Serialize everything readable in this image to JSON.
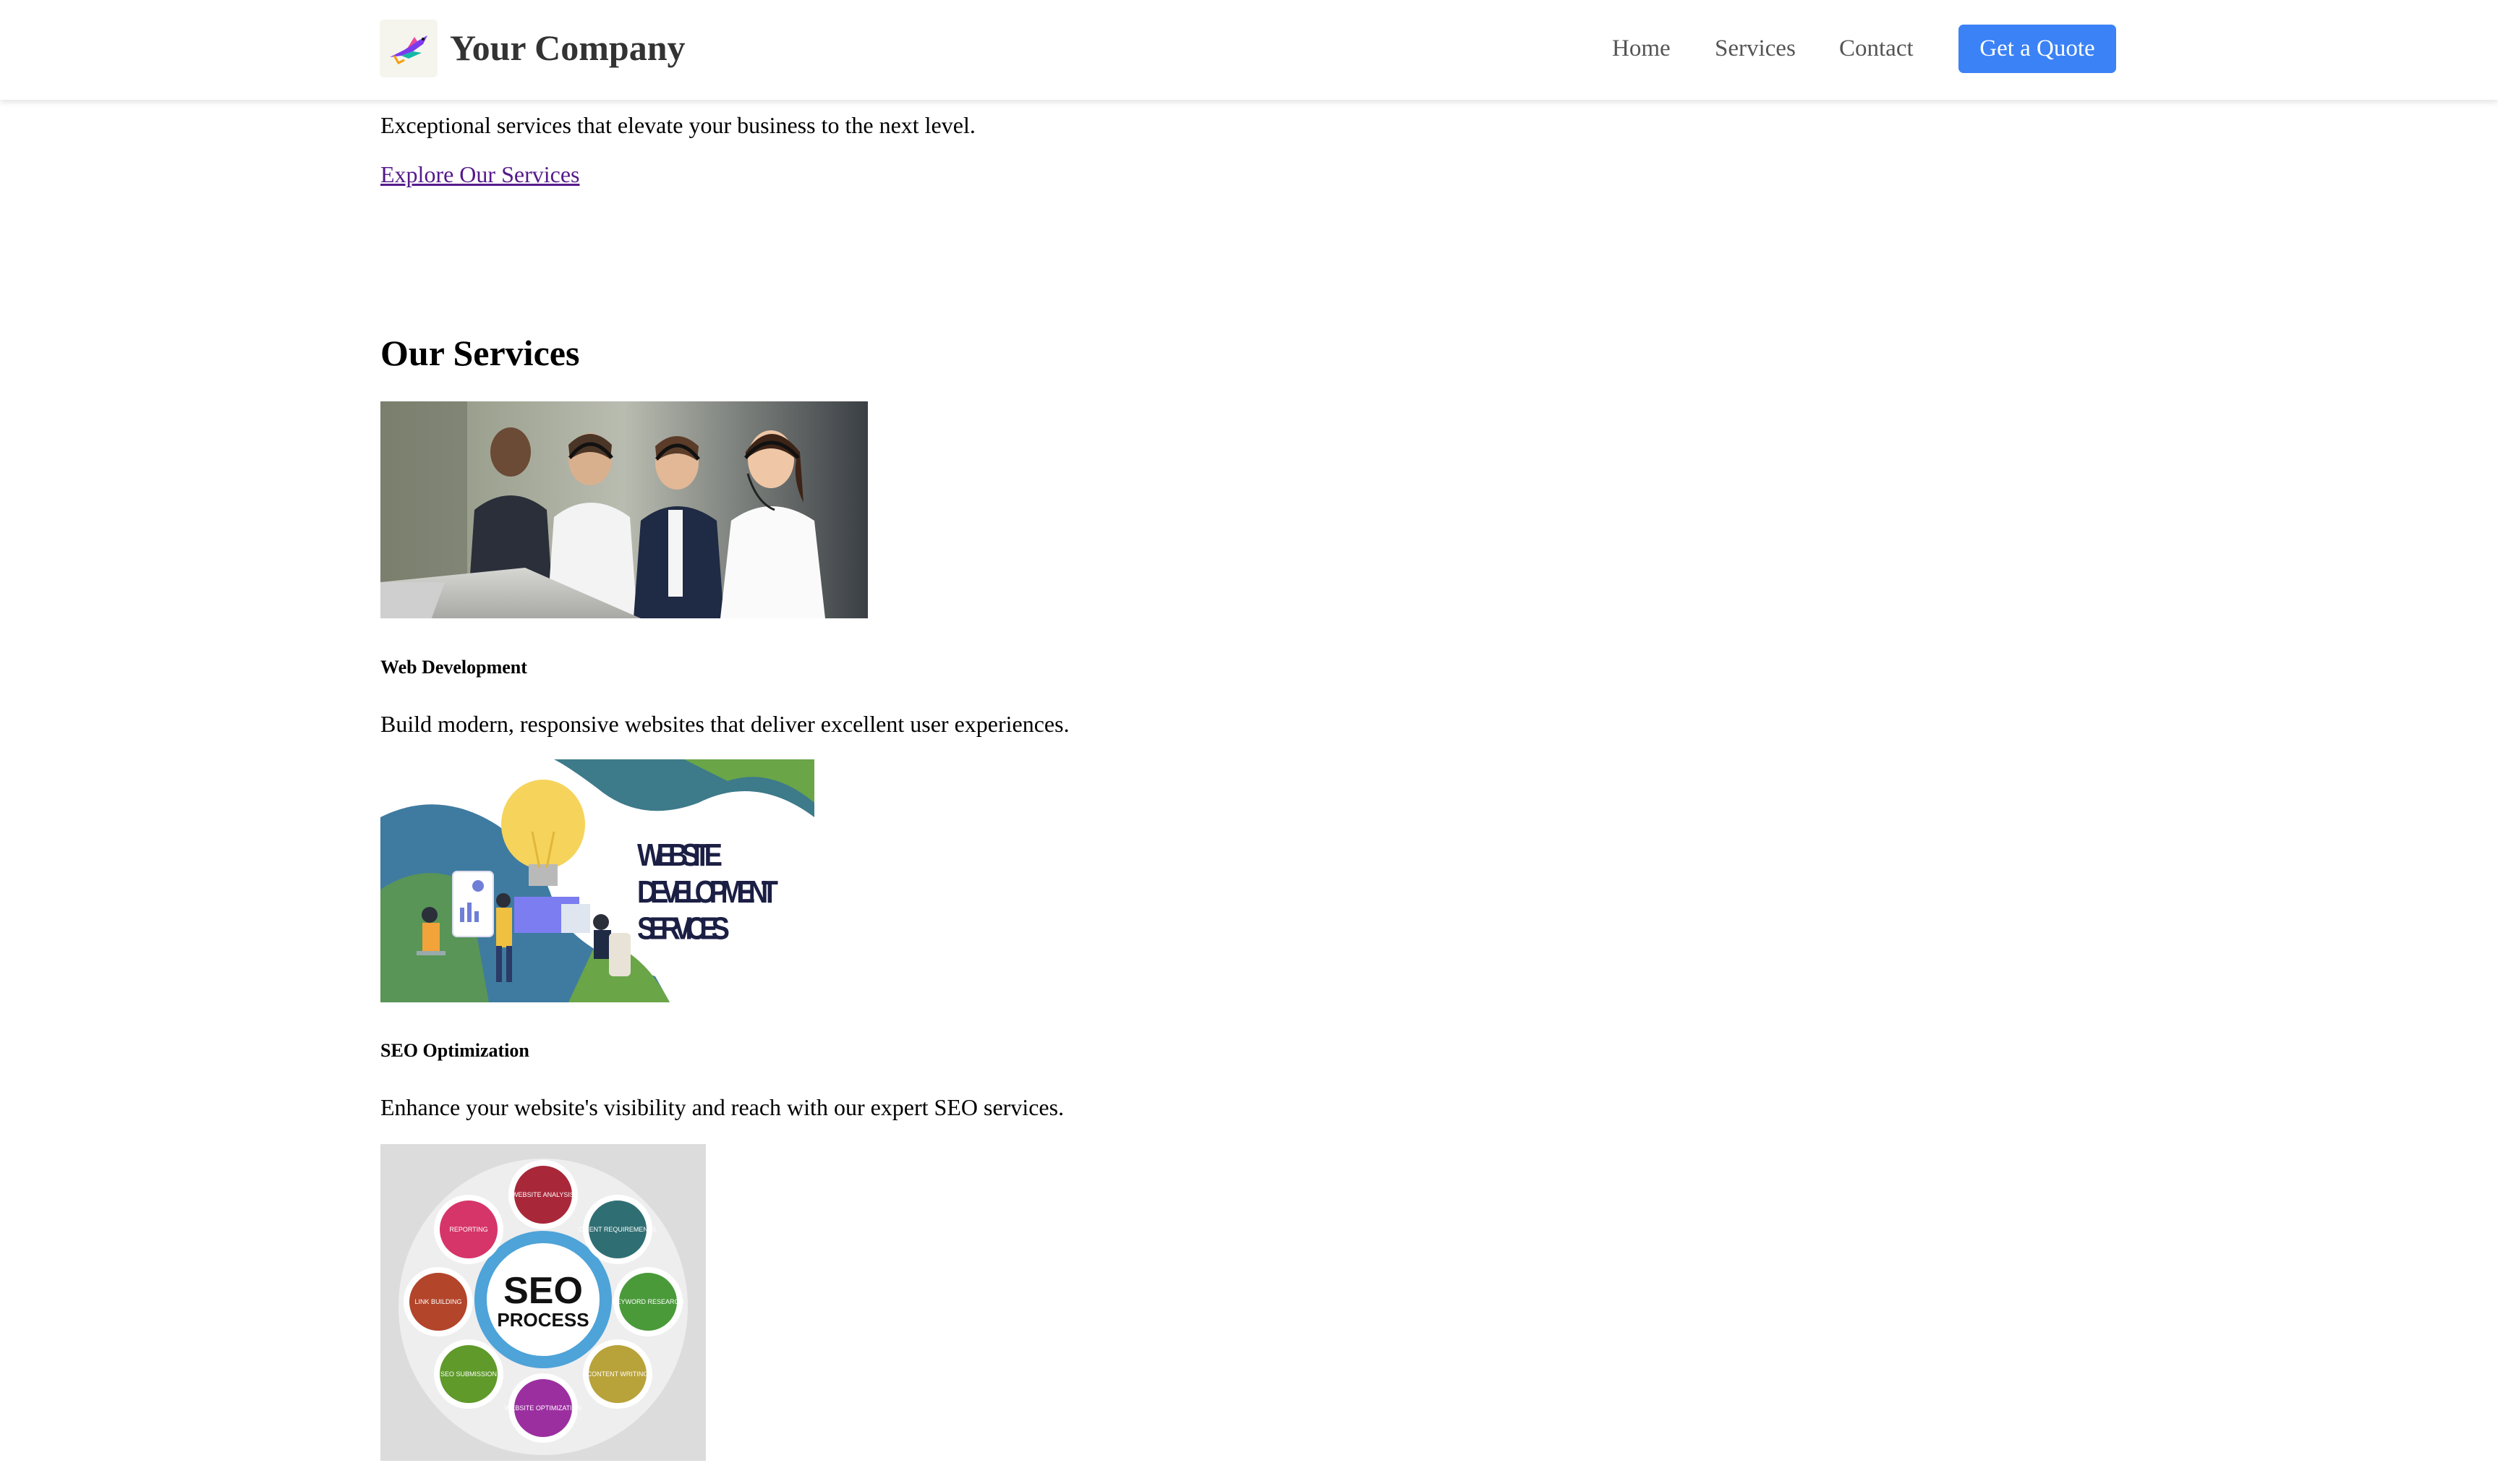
{
  "header": {
    "brand": "Your Company",
    "logo_icon": "bird-logo-icon",
    "nav": [
      {
        "label": "Home"
      },
      {
        "label": "Services"
      },
      {
        "label": "Contact"
      }
    ],
    "cta_label": "Get a Quote",
    "accent_color": "#3b82f6"
  },
  "hero": {
    "tagline": "Exceptional services that elevate your business to the next level.",
    "link_label": "Explore Our Services"
  },
  "services": {
    "heading": "Our Services",
    "items": [
      {
        "title": "Web Development",
        "description": "Build modern, responsive websites that deliver excellent user experiences."
      },
      {
        "title": "SEO Optimization",
        "description": "Enhance your website's visibility and reach with our expert SEO services."
      }
    ]
  },
  "images": {
    "support_team_photo": "call-center-team-photo",
    "web_dev_banner": {
      "lines": [
        "WEBSITE",
        "DEVELOPMENT",
        "SERVICES"
      ]
    },
    "seo_process": {
      "center_top": "SEO",
      "center_bottom": "PROCESS",
      "segments": [
        "WEBSITE ANALYSIS",
        "CLIENT REQUIREMENTS",
        "KEYWORD RESEARCH",
        "CONTENT WRITING",
        "WEBSITE OPTIMIZATION",
        "SEO SUBMISSION",
        "LINK BUILDING",
        "REPORTING"
      ]
    }
  }
}
